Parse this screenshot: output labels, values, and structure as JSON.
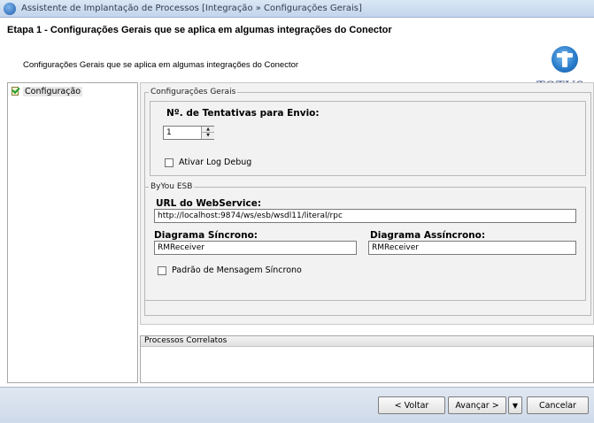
{
  "window": {
    "title": "Assistente de Implantação de Processos [Integração » Configurações Gerais]",
    "app_icon": "totvs-globe-icon"
  },
  "header": {
    "step_title": "Etapa 1 - Configurações Gerais que se aplica em algumas integrações do Conector",
    "step_subtitle": "Configurações Gerais que se aplica em algumas integrações do Conector",
    "logo_text": "TOTVS"
  },
  "tree": {
    "items": [
      {
        "label": "Configuração",
        "icon": "checked-page-icon",
        "selected": true
      }
    ]
  },
  "general": {
    "group_label": "Configurações Gerais",
    "retries_label": "Nº. de Tentativas para Envio:",
    "retries_value": "1",
    "log_debug_label": "Ativar Log Debug",
    "log_debug_checked": false
  },
  "esb": {
    "group_label": "ByYou ESB",
    "url_label": "URL do WebService:",
    "url_value": "http://localhost:9874/ws/esb/wsdl11/literal/rpc",
    "sync_label": "Diagrama Síncrono:",
    "sync_value": "RMReceiver",
    "async_label": "Diagrama Assíncrono:",
    "async_value": "RMReceiver",
    "sync_pattern_label": "Padrão de Mensagem Síncrono",
    "sync_pattern_checked": false
  },
  "processes": {
    "header": "Processos Correlatos"
  },
  "footer": {
    "back_label": "< Voltar",
    "next_label": "Avançar >",
    "dropdown_glyph": "▼",
    "cancel_label": "Cancelar"
  }
}
